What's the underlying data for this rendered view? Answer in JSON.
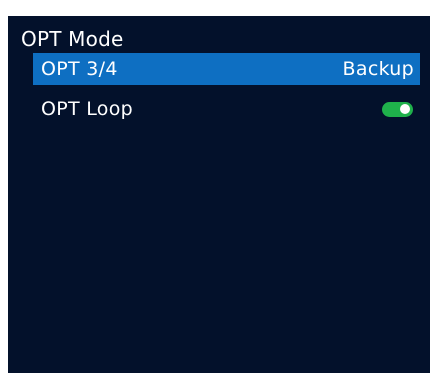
{
  "menu": {
    "title": "OPT Mode",
    "items": [
      {
        "label": "OPT 3/4",
        "value": "Backup",
        "selected": true
      },
      {
        "label": "OPT Loop",
        "toggle": "on",
        "selected": false
      }
    ]
  },
  "colors": {
    "screen_background": "#03112b",
    "selection_highlight": "#0e6fc2",
    "toggle_on": "#1fb14b",
    "text": "#ffffff"
  }
}
